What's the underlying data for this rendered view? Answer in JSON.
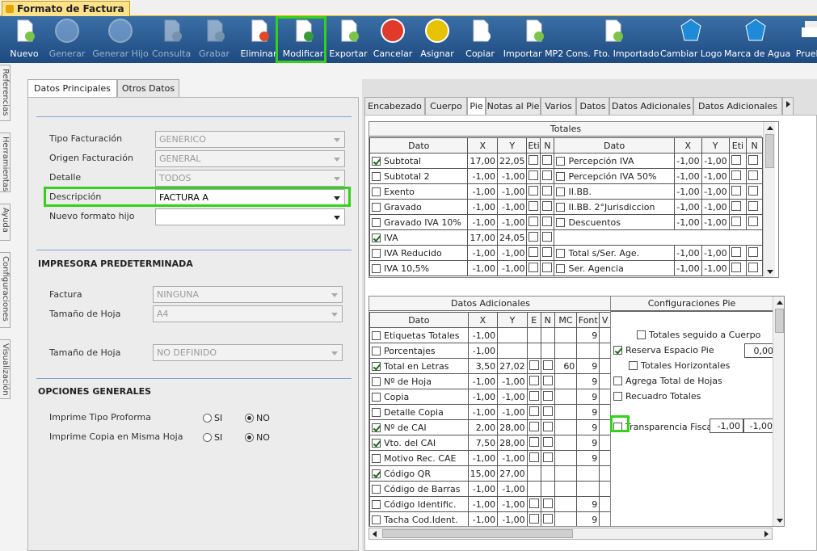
{
  "window": {
    "title": "Formato de Factura"
  },
  "toolbar": [
    {
      "label": "Nuevo",
      "icon": "new-doc-icon",
      "enabled": true
    },
    {
      "label": "Generar",
      "icon": "thumbs-up-icon",
      "enabled": false
    },
    {
      "label": "Generar Hijo",
      "icon": "thumbs-up-child-icon",
      "enabled": false
    },
    {
      "label": "Consulta",
      "icon": "query-icon",
      "enabled": false
    },
    {
      "label": "Grabar",
      "icon": "save-icon",
      "enabled": false
    },
    {
      "label": "Eliminar",
      "icon": "delete-doc-icon",
      "enabled": true
    },
    {
      "label": "Modificar",
      "icon": "edit-pencil-icon",
      "enabled": true
    },
    {
      "label": "Exportar",
      "icon": "export-icon",
      "enabled": true
    },
    {
      "label": "Cancelar",
      "icon": "cancel-icon",
      "enabled": true
    },
    {
      "label": "Asignar",
      "icon": "assign-icon",
      "enabled": true
    },
    {
      "label": "Copiar",
      "icon": "copy-icon",
      "enabled": true
    },
    {
      "label": "Importar MP2",
      "icon": "import-icon",
      "enabled": true
    },
    {
      "label": "Cons. Fto. Importado",
      "icon": "import-query-icon",
      "enabled": true
    },
    {
      "label": "Cambiar Logo",
      "icon": "logo-icon",
      "enabled": true
    },
    {
      "label": "Marca de Agua",
      "icon": "watermark-icon",
      "enabled": true
    },
    {
      "label": "Prueba",
      "icon": "printer-icon",
      "enabled": true
    }
  ],
  "side_tabs": [
    "Referencias",
    "Herramientas",
    "Ayuda",
    "Configuraciones",
    "Visualización"
  ],
  "left": {
    "tabs": [
      "Datos Principales",
      "Otros Datos"
    ],
    "fields": [
      {
        "label": "Tipo Facturación",
        "value": "GENERICO"
      },
      {
        "label": "Origen Facturación",
        "value": "GENERAL"
      },
      {
        "label": "Detalle",
        "value": "TODOS"
      },
      {
        "label": "Descripción",
        "value": "FACTURA A"
      },
      {
        "label": "Nuevo formato hijo",
        "value": ""
      }
    ],
    "printer_title": "IMPRESORA PREDETERMINADA",
    "printer_fields": [
      {
        "label": "Factura",
        "value": "NINGUNA"
      },
      {
        "label": "Tamaño de Hoja",
        "value": "A4"
      },
      {
        "label": "Tamaño de Hoja",
        "value": "NO DEFINIDO"
      }
    ],
    "options_title": "OPCIONES GENERALES",
    "options": [
      {
        "label": "Imprime Tipo Proforma",
        "si": "SI",
        "no": "NO",
        "selected": "NO"
      },
      {
        "label": "Imprime Copia en Misma Hoja",
        "si": "SI",
        "no": "NO",
        "selected": "NO"
      }
    ]
  },
  "right": {
    "tabs": [
      "Encabezado",
      "Cuerpo",
      "Pie",
      "Notas al Pie",
      "Varios",
      "Datos",
      "Datos Adicionales",
      "Datos Adicionales"
    ],
    "totales": {
      "title": "Totales",
      "headers": [
        "Dato",
        "X",
        "Y",
        "Eti",
        "N",
        "Dato",
        "X",
        "Y",
        "Eti",
        "N"
      ],
      "rows": [
        {
          "l": {
            "name": "Subtotal",
            "on": true,
            "x": "17,00",
            "y": "22,05"
          },
          "r": {
            "name": "Percepción IVA",
            "on": false,
            "x": "-1,00",
            "y": "-1,00"
          }
        },
        {
          "l": {
            "name": "Subtotal 2",
            "on": false,
            "x": "-1,00",
            "y": "-1,00"
          },
          "r": {
            "name": "Percepción IVA 50%",
            "on": false,
            "x": "-1,00",
            "y": "-1,00"
          }
        },
        {
          "l": {
            "name": "Exento",
            "on": false,
            "x": "-1,00",
            "y": "-1,00"
          },
          "r": {
            "name": "II.BB.",
            "on": false,
            "x": "-1,00",
            "y": "-1,00"
          }
        },
        {
          "l": {
            "name": "Gravado",
            "on": false,
            "x": "-1,00",
            "y": "-1,00"
          },
          "r": {
            "name": "II.BB. 2°Jurisdiccion",
            "on": false,
            "x": "-1,00",
            "y": "-1,00"
          }
        },
        {
          "l": {
            "name": "Gravado IVA 10%",
            "on": false,
            "x": "-1,00",
            "y": "-1,00"
          },
          "r": {
            "name": "Descuentos",
            "on": false,
            "x": "-1,00",
            "y": "-1,00"
          }
        },
        {
          "l": {
            "name": "IVA",
            "on": true,
            "x": "17,00",
            "y": "24,05"
          },
          "r": {
            "name": "",
            "on": null,
            "x": "",
            "y": ""
          }
        },
        {
          "l": {
            "name": "IVA Reducido",
            "on": false,
            "x": "-1,00",
            "y": "-1,00"
          },
          "r": {
            "name": "Total s/Ser. Age.",
            "on": false,
            "x": "-1,00",
            "y": "-1,00"
          }
        },
        {
          "l": {
            "name": "IVA 10,5%",
            "on": false,
            "x": "-1,00",
            "y": "-1,00"
          },
          "r": {
            "name": "Ser. Agencia",
            "on": false,
            "x": "-1,00",
            "y": "-1,00"
          }
        }
      ]
    },
    "adicionales": {
      "title": "Datos Adicionales",
      "headers": [
        "Dato",
        "X",
        "Y",
        "E",
        "N",
        "MC",
        "Font",
        "V"
      ],
      "rows": [
        {
          "name": "Etiquetas Totales",
          "on": false,
          "x": "-1,00",
          "y": "",
          "mc": "",
          "font": "9"
        },
        {
          "name": "Porcentajes",
          "on": false,
          "x": "-1,00",
          "y": "",
          "mc": "",
          "font": ""
        },
        {
          "name": "Total en Letras",
          "on": true,
          "x": "3,50",
          "y": "27,02",
          "mc": "60",
          "font": "9"
        },
        {
          "name": "Nº de Hoja",
          "on": false,
          "x": "-1,00",
          "y": "-1,00",
          "mc": "",
          "font": "9"
        },
        {
          "name": "Copia",
          "on": false,
          "x": "-1,00",
          "y": "-1,00",
          "mc": "",
          "font": "9"
        },
        {
          "name": "Detalle Copia",
          "on": false,
          "x": "-1,00",
          "y": "-1,00",
          "mc": "",
          "font": "9"
        },
        {
          "name": "Nº de CAI",
          "on": true,
          "x": "2,00",
          "y": "28,00",
          "mc": "",
          "font": "9"
        },
        {
          "name": "Vto. del CAI",
          "on": true,
          "x": "7,50",
          "y": "28,00",
          "mc": "",
          "font": "9"
        },
        {
          "name": "Motivo Rec. CAE",
          "on": false,
          "x": "-1,00",
          "y": "-1,00",
          "mc": "",
          "font": "9"
        },
        {
          "name": "Código QR",
          "on": true,
          "x": "15,00",
          "y": "27,00",
          "mc": "",
          "font": ""
        },
        {
          "name": "Código de Barras",
          "on": false,
          "x": "-1,00",
          "y": "-1,00",
          "mc": "",
          "font": ""
        },
        {
          "name": "Código Identific.",
          "on": false,
          "x": "-1,00",
          "y": "-1,00",
          "mc": "",
          "font": "9"
        },
        {
          "name": "Tacha Cod.Ident.",
          "on": false,
          "x": "-1,00",
          "y": "-1,00",
          "mc": "",
          "font": "9"
        }
      ]
    },
    "config_pie": {
      "title": "Configuraciones Pie",
      "totales_seguido": "Totales seguido a Cuerpo",
      "reserva": "Reserva Espacio Pie",
      "reserva_val": "0,00",
      "totales_horiz": "Totales Horizontales",
      "agrega": "Agrega Total de Hojas",
      "recuadro": "Recuadro Totales",
      "transparencia": "Transparencia Fiscal",
      "transp_x": "-1,00",
      "transp_y": "-1,00"
    }
  },
  "colors": {
    "highlight": "#33d11a",
    "toolbar_top": "#3a6fa6",
    "toolbar_bottom": "#1e4a80"
  }
}
